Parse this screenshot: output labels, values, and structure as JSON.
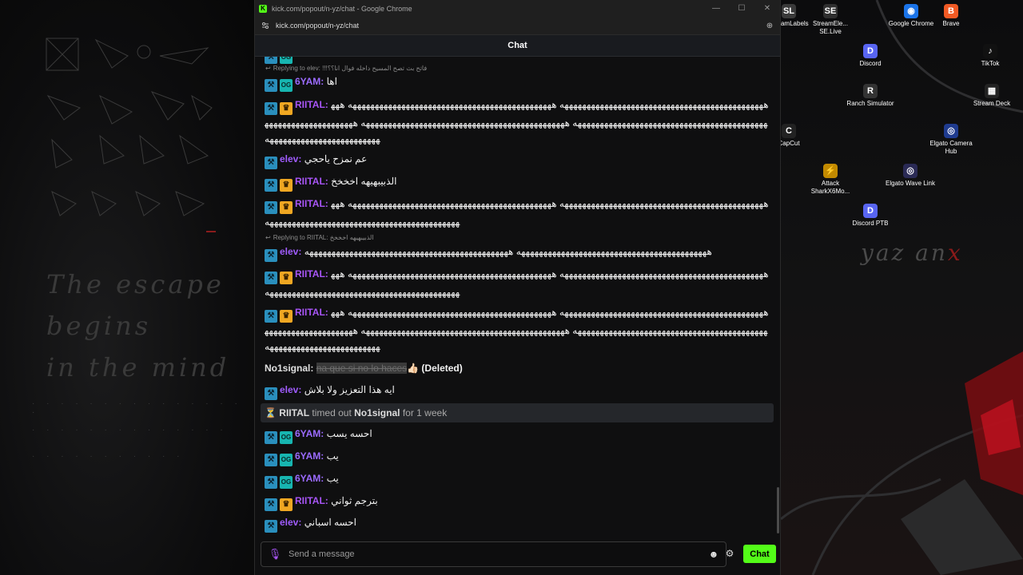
{
  "browser": {
    "window_title": "kick.com/popout/n-yz/chat - Google Chrome",
    "url": "kick.com/popout/n-yz/chat",
    "logo_letter": "K",
    "controls": {
      "minimize": "—",
      "maximize": "☐",
      "close": "✕"
    },
    "zoom_icon": "⊕"
  },
  "chat": {
    "header_title": "Chat",
    "replies": [
      {
        "text": "Replying to elev: !!!فاتح بث تصح المسيح داخله فوال انا؟؟"
      },
      {
        "text": "Replying to RIITAL: الذبيبهيهه اخخخخ"
      }
    ],
    "messages": [
      {
        "user": "6YAM",
        "text": "اها"
      },
      {
        "user": "RIITAL",
        "text": "ههههههههههههههههههههههههههههههههههههههههههههههه ههههههههههههههههههههههههههههههههههههههههههههههه ههههههههههههههههههههههههههههههههههههههههههههههه ههههههههههههههههههههههههههههههههههههههههههههههه ههههههههههههههههههههههههههههههههههههههههههههههه"
      },
      {
        "user": "elev",
        "text": "عم نمزح ياحجي"
      },
      {
        "user": "RIITAL",
        "text": "الذبيبهيهه اخخخخ"
      },
      {
        "user": "RIITAL",
        "text": "ههههههههههههههههههههههههههههههههههههههههههههههه ههههههههههههههههههههههههههههههههههههههههههههههه ههههههههههههههههههههههههههههههههههههههههههههههه"
      },
      {
        "user": "elev",
        "text": "هههههههههههههههههههههههههههههههههههههههههههه ههههههههههههههههههههههههههههههههههههههههههههههه"
      },
      {
        "user": "RIITAL",
        "text": "ههههههههههههههههههههههههههههههههههههههههههههههه ههههههههههههههههههههههههههههههههههههههههههههههه ههههههههههههههههههههههههههههههههههههههههههههههه"
      },
      {
        "user": "RIITAL",
        "text": "ههههههههههههههههههههههههههههههههههههههههههههههه ههههههههههههههههههههههههههههههههههههههههههههههه ههههههههههههههههههههههههههههههههههههههههههههههه ههههههههههههههههههههههههههههههههههههههههههههههه ههههههههههههههههههههههههههههههههههههههههههههههه"
      },
      {
        "user": "No1signal",
        "text": "na que si no lo haces",
        "emoji": "👍🏻",
        "deleted_tag": "(Deleted)"
      },
      {
        "user": "elev",
        "text": "ايه هذا التعزيز ولا بلاش"
      },
      {
        "user": "6YAM",
        "text": "احسه يسب"
      },
      {
        "user": "6YAM",
        "text": "يب"
      },
      {
        "user": "6YAM",
        "text": "يب"
      },
      {
        "user": "RIITAL",
        "text": "بترجم ثواني"
      },
      {
        "user": "elev",
        "text": "احسه اسباني"
      }
    ],
    "timeout": {
      "icon": "⏳",
      "moderator": "RIITAL",
      "action": "timed out",
      "target": "No1signal",
      "duration": "for 1 week"
    },
    "input": {
      "placeholder": "Send a message",
      "value": "",
      "send_label": "Chat"
    },
    "badges": {
      "og_text": "OG",
      "mod_glyph": "⚒",
      "crown_glyph": "♛"
    },
    "colors": {
      "accent": "#53fc18",
      "username_purple": "#a855f7"
    }
  },
  "wallpaper": {
    "quote_lines": [
      "The escape",
      "begins",
      "in the mind"
    ],
    "signature": "yaz an",
    "signature_mark": "x"
  },
  "desktop_icons": [
    {
      "label": "StreamLabels",
      "short": "SL",
      "color": "#3a3a3a"
    },
    {
      "label": "StreamEle... SE.Live",
      "short": "SE",
      "color": "#2f2f2f"
    },
    {
      "label": "Google Chrome",
      "short": "◉",
      "color": "#1a73e8"
    },
    {
      "label": "Brave",
      "short": "B",
      "color": "#f15a24"
    },
    {
      "label": "Discord",
      "short": "D",
      "color": "#5865f2"
    },
    {
      "label": "TikTok",
      "short": "♪",
      "color": "#111111"
    },
    {
      "label": "Ranch Simulator",
      "short": "R",
      "color": "#333333"
    },
    {
      "label": "Stream Deck",
      "short": "▦",
      "color": "#222222"
    },
    {
      "label": "CapCut",
      "short": "C",
      "color": "#222222"
    },
    {
      "label": "Elgato Camera Hub",
      "short": "◎",
      "color": "#1f3b8f"
    },
    {
      "label": "Attack SharkX6Mo...",
      "short": "⚡",
      "color": "#c28a00"
    },
    {
      "label": "Elgato Wave Link",
      "short": "◎",
      "color": "#2a2a55"
    },
    {
      "label": "Discord PTB",
      "short": "D",
      "color": "#5865f2"
    }
  ]
}
